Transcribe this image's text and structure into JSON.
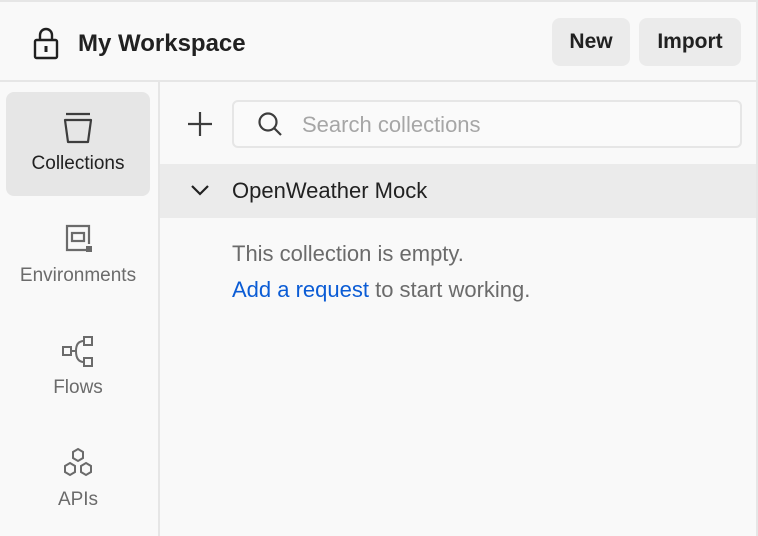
{
  "header": {
    "workspace_title": "My Workspace",
    "lock_icon": "lock-icon",
    "new_label": "New",
    "import_label": "Import"
  },
  "sidebar": {
    "items": [
      {
        "label": "Collections",
        "icon": "collections-icon",
        "active": true
      },
      {
        "label": "Environments",
        "icon": "environments-icon",
        "active": false
      },
      {
        "label": "Flows",
        "icon": "flows-icon",
        "active": false
      },
      {
        "label": "APIs",
        "icon": "apis-icon",
        "active": false
      }
    ]
  },
  "main": {
    "search": {
      "placeholder": "Search collections",
      "value": ""
    },
    "collections": [
      {
        "name": "OpenWeather Mock",
        "expanded": true,
        "empty_message": "This collection is empty.",
        "add_request_link": "Add a request",
        "add_request_suffix": " to start working."
      }
    ]
  },
  "colors": {
    "link": "#0b5cd5",
    "active_nav_bg": "#e6e6e6",
    "button_bg": "#ebebeb",
    "background": "#f9f9f9"
  }
}
